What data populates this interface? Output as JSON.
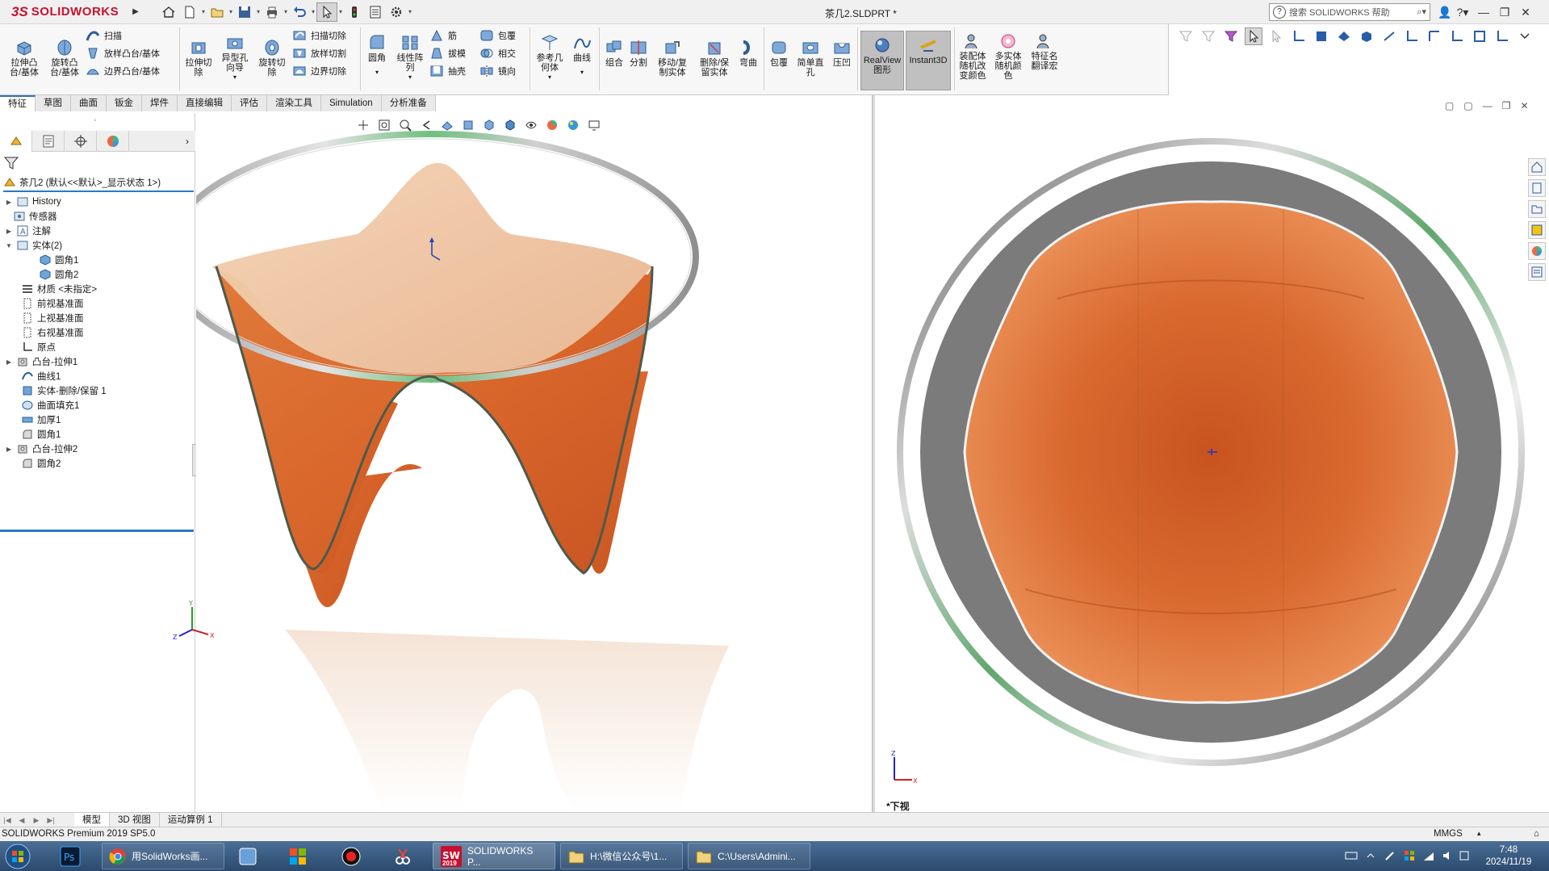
{
  "app": {
    "logo_ds": "3S",
    "logo_name": "SOLIDWORKS",
    "document_title": "茶几2.SLDPRT *",
    "help_search_placeholder": "搜索 SOLIDWORKS 帮助"
  },
  "ribbon": {
    "extrude_boss": "拉伸凸\n台/基体",
    "revolve_boss": "旋转凸\n台/基体",
    "sweep": "扫描",
    "loft_boss": "放样凸台/基体",
    "boundary_boss": "边界凸台/基体",
    "extrude_cut": "拉伸切\n除",
    "hole_wizard": "异型孔\n向导",
    "revolve_cut": "旋转切\n除",
    "swept_cut": "扫描切除",
    "lofted_cut": "放样切割",
    "boundary_cut": "边界切除",
    "fillet": "圆角",
    "linear_pattern": "线性阵\n列",
    "rib": "筋",
    "draft": "拔模",
    "shell": "抽壳",
    "wrap": "包覆",
    "intersect": "相交",
    "mirror": "镜向",
    "ref_geometry": "参考几\n何体",
    "curves": "曲线",
    "combine": "组合",
    "split": "分割",
    "move_copy": "移动/复\n制实体",
    "delete_keep": "删除/保\n留实体",
    "flex": "弯曲",
    "wrap2": "包覆",
    "simple_hole": "简单直\n孔",
    "indent": "压凹",
    "realview": "RealView\n图形",
    "instant3d": "Instant3D",
    "assembly_color": "装配体\n随机改\n变颜色",
    "multibody_color": "多实体\n随机颜\n色",
    "feature_translate": "特征名\n翻译宏"
  },
  "cm_tabs": [
    "特征",
    "草图",
    "曲面",
    "钣金",
    "焊件",
    "直接编辑",
    "评估",
    "渲染工具",
    "Simulation",
    "分析准备"
  ],
  "tree": {
    "root": "茶几2 (默认<<默认>_显示状态 1>)",
    "nodes": [
      {
        "label": "History"
      },
      {
        "label": "传感器"
      },
      {
        "label": "注解"
      },
      {
        "label": "实体(2)"
      },
      {
        "label": "圆角1"
      },
      {
        "label": "圆角2"
      },
      {
        "label": "材质 <未指定>"
      },
      {
        "label": "前视基准面"
      },
      {
        "label": "上视基准面"
      },
      {
        "label": "右视基准面"
      },
      {
        "label": "原点"
      },
      {
        "label": "凸台-拉伸1"
      },
      {
        "label": "曲线1"
      },
      {
        "label": "实体-删除/保留 1"
      },
      {
        "label": "曲面填充1"
      },
      {
        "label": "加厚1"
      },
      {
        "label": "圆角1"
      },
      {
        "label": "凸台-拉伸2"
      },
      {
        "label": "圆角2"
      }
    ]
  },
  "viewport": {
    "right_view_label": "*下视",
    "axis_x": "X",
    "axis_y": "Y",
    "axis_z": "Z"
  },
  "bottom_tabs": [
    "模型",
    "3D 视图",
    "运动算例 1"
  ],
  "status": {
    "product": "SOLIDWORKS Premium 2019 SP5.0",
    "units": "MMGS"
  },
  "taskbar": {
    "items": [
      {
        "label": "用SolidWorks画..."
      },
      {
        "label": "SOLIDWORKS P..."
      },
      {
        "label": "H:\\微信公众号\\1..."
      },
      {
        "label": "C:\\Users\\Admini..."
      }
    ],
    "time": "7:48",
    "date": "2024/11/19",
    "sw_badge": "2019"
  },
  "colors": {
    "wood_light": "#f3c9a8",
    "wood_dark": "#d9622a",
    "ring_gray": "#7a7a7a",
    "accent": "#2c78c8",
    "brand": "#c8102e"
  }
}
